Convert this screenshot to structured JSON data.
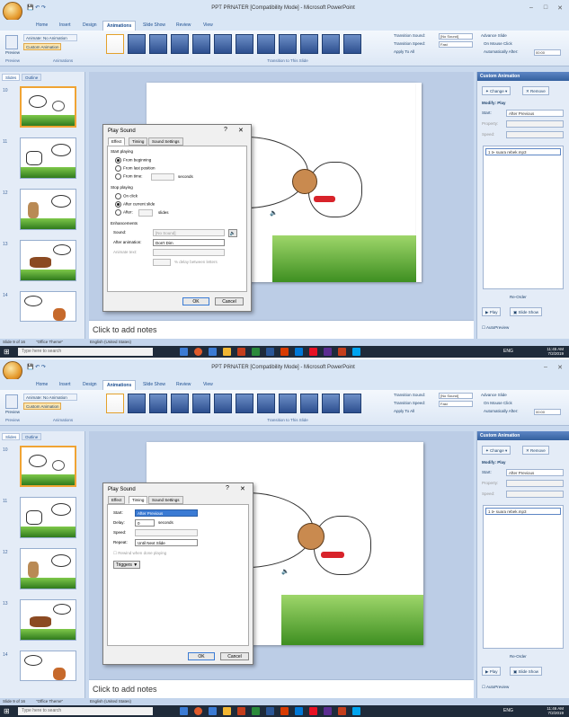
{
  "app": {
    "title_1": "PPT PRNATER [Compatibility Mode] - Microsoft PowerPoint",
    "title_2": "PPT PRNATER [Compatibility Mode] - Microsoft PowerPoint",
    "min": "–",
    "max": "□",
    "close": "✕"
  },
  "ribbon": {
    "tabs": [
      "Home",
      "Insert",
      "Design",
      "Animations",
      "Slide Show",
      "Review",
      "View"
    ],
    "active_tab": "Animations",
    "preview_label": "Preview",
    "preview_group": "Preview",
    "animate_label": "Animate:",
    "animate_value": "No Animation",
    "custom_animation_label": "Custom Animation",
    "animations_group": "Animations",
    "transition_group": "Transition to This Slide",
    "transition_sound_label": "Transition Sound:",
    "transition_sound_value": "[No Sound]",
    "transition_speed_label": "Transition Speed:",
    "transition_speed_value": "Fast",
    "apply_all_label": "Apply To All",
    "advance_slide_label": "Advance Slide",
    "on_mouse_click_label": "On Mouse Click",
    "auto_after_label": "Automatically After:",
    "auto_after_value": "00:00"
  },
  "left_pane": {
    "tab_slides": "Slides",
    "tab_outline": "Outline",
    "slide_numbers": [
      "10",
      "11",
      "12",
      "13",
      "14"
    ]
  },
  "notes": {
    "text": "Click to add notes"
  },
  "custom_animation": {
    "title": "Custom Animation",
    "change_label": "Change",
    "remove_label": "Remove",
    "modify_label": "Modify: Play",
    "start_label": "Start:",
    "start_value": "After Previous",
    "property_label": "Property:",
    "speed_label": "Speed:",
    "list_item": "1  ⊳  suara rebek.mp3",
    "reorder_label": "Re-Order",
    "play_label": "Play",
    "slide_show_label": "Slide Show",
    "autopreview_label": "AutoPreview"
  },
  "status": {
    "slide_info": "Slide 9 of 16",
    "theme": "\"Office Theme\"",
    "language": "English (United States)"
  },
  "taskbar": {
    "search_placeholder": "Type here to search",
    "time_1": "11:45 AM",
    "date_1": "7/2/2019",
    "time_2": "11:46 AM",
    "date_2": "7/2/2019",
    "lang": "ENG"
  },
  "dialog1": {
    "title": "Play Sound",
    "help": "?",
    "close": "✕",
    "tabs": [
      "Effect",
      "Timing",
      "Sound Settings"
    ],
    "active_tab": "Effect",
    "start_playing_heading": "Start playing",
    "from_beginning": "From beginning",
    "from_last_position": "From last position",
    "from_time": "From time:",
    "seconds": "seconds",
    "stop_playing_heading": "Stop playing",
    "on_click": "On click",
    "after_current_slide": "After current slide",
    "after": "After:",
    "slides": "slides",
    "enhancements_heading": "Enhancements",
    "sound_label": "Sound:",
    "sound_value": "[No Sound]",
    "after_animation_label": "After animation:",
    "after_animation_value": "Don't Dim",
    "animate_text_label": "Animate text:",
    "delay_between_letters": "% delay between letters",
    "ok": "OK",
    "cancel": "Cancel"
  },
  "dialog2": {
    "title": "Play Sound",
    "help": "?",
    "close": "✕",
    "tabs": [
      "Effect",
      "Timing",
      "Sound Settings"
    ],
    "active_tab": "Timing",
    "start_label": "Start:",
    "start_value": "After Previous",
    "delay_label": "Delay:",
    "delay_value": "0",
    "seconds": "seconds",
    "speed_label": "Speed:",
    "repeat_label": "Repeat:",
    "repeat_value": "Until Next Slide",
    "rewind_label": "Rewind when done playing",
    "triggers_label": "Triggers ▼",
    "ok": "OK",
    "cancel": "Cancel"
  },
  "colors": {
    "ribbon_bg": "#dce7f5",
    "accent": "#f0a434",
    "taskbar": "#1f2b3a",
    "sheep_scarf": "#d8232a"
  }
}
